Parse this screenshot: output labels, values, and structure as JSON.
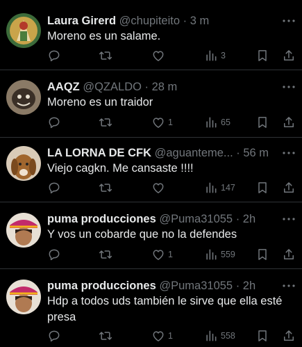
{
  "colors": {
    "background": "#000000",
    "text": "#e7e9ea",
    "muted": "#71767b",
    "divider": "#2f3336"
  },
  "tweets": [
    {
      "name": "Laura Girerd",
      "handle": "@chupiteito",
      "dot": "·",
      "time": "3 m",
      "text": "Moreno es un salame.",
      "replies": "",
      "retweets": "",
      "likes": "",
      "views": "3"
    },
    {
      "name": "AAQZ",
      "handle": "@QZALDO",
      "dot": "·",
      "time": "28 m",
      "text": "Moreno es un traidor",
      "replies": "",
      "retweets": "",
      "likes": "1",
      "views": "65"
    },
    {
      "name": "LA LORNA DE CFK",
      "handle": "@aguanteme...",
      "dot": "·",
      "time": "56 m",
      "text": "Viejo cagkn. Me cansaste !!!!",
      "replies": "",
      "retweets": "",
      "likes": "",
      "views": "147"
    },
    {
      "name": "puma producciones",
      "handle": "@Puma31055",
      "dot": "·",
      "time": "2h",
      "text": "Y vos un cobarde que no la defendes",
      "replies": "",
      "retweets": "",
      "likes": "1",
      "views": "559"
    },
    {
      "name": "puma producciones",
      "handle": "@Puma31055",
      "dot": "·",
      "time": "2h",
      "text": "Hdp a todos uds también le sirve que ella esté presa",
      "replies": "",
      "retweets": "",
      "likes": "1",
      "views": "558"
    }
  ],
  "icons": [
    "reply-icon",
    "retweet-icon",
    "like-icon",
    "views-icon",
    "bookmark-icon",
    "share-icon",
    "more-icon"
  ]
}
